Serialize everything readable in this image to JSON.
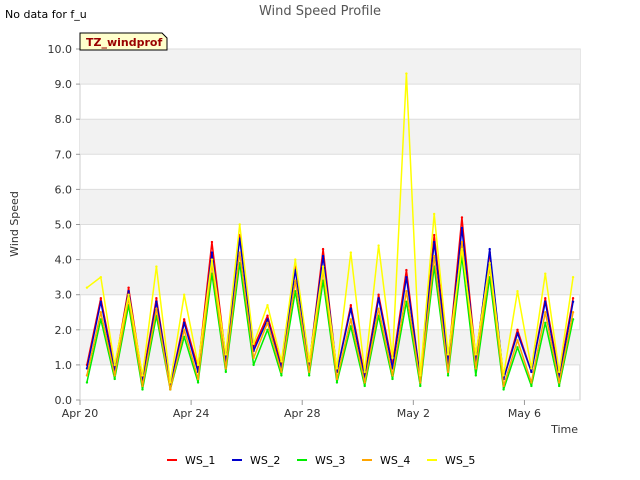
{
  "chart_data": {
    "type": "line",
    "title": "Wind Speed Profile",
    "corner_note": "No data for f_u",
    "tag": "TZ_windprof",
    "xlabel": "Time",
    "ylabel": "Wind Speed",
    "ylim": [
      0,
      10
    ],
    "xlim": [
      "2023-04-20",
      "2023-05-08"
    ],
    "y_ticks": [
      "0.0",
      "1.0",
      "2.0",
      "3.0",
      "4.0",
      "5.0",
      "6.0",
      "7.0",
      "8.0",
      "9.0",
      "10.0"
    ],
    "x_ticks": [
      {
        "date": "2023-04-20",
        "label": "Apr 20"
      },
      {
        "date": "2023-04-24",
        "label": "Apr 24"
      },
      {
        "date": "2023-04-28",
        "label": "Apr 28"
      },
      {
        "date": "2023-05-02",
        "label": "May 2"
      },
      {
        "date": "2023-05-06",
        "label": "May 6"
      }
    ],
    "grid": true,
    "legend_position": "bottom",
    "x": [
      "2023-04-20 06:00",
      "2023-04-20 18:00",
      "2023-04-21 06:00",
      "2023-04-21 18:00",
      "2023-04-22 06:00",
      "2023-04-22 18:00",
      "2023-04-23 06:00",
      "2023-04-23 18:00",
      "2023-04-24 06:00",
      "2023-04-24 18:00",
      "2023-04-25 06:00",
      "2023-04-25 18:00",
      "2023-04-26 06:00",
      "2023-04-26 18:00",
      "2023-04-27 06:00",
      "2023-04-27 18:00",
      "2023-04-28 06:00",
      "2023-04-28 18:00",
      "2023-04-29 06:00",
      "2023-04-29 18:00",
      "2023-04-30 06:00",
      "2023-04-30 18:00",
      "2023-05-01 06:00",
      "2023-05-01 18:00",
      "2023-05-02 06:00",
      "2023-05-02 18:00",
      "2023-05-03 06:00",
      "2023-05-03 18:00",
      "2023-05-04 06:00",
      "2023-05-04 18:00",
      "2023-05-05 06:00",
      "2023-05-05 18:00",
      "2023-05-06 06:00",
      "2023-05-06 18:00",
      "2023-05-07 06:00",
      "2023-05-07 18:00"
    ],
    "series": [
      {
        "name": "WS_1",
        "color": "#ff0000",
        "values": [
          1.0,
          2.9,
          0.9,
          3.2,
          0.6,
          2.9,
          0.4,
          2.3,
          0.9,
          4.5,
          1.2,
          4.7,
          1.5,
          2.4,
          1.0,
          3.8,
          1.0,
          4.3,
          0.8,
          2.7,
          0.7,
          3.0,
          1.0,
          3.7,
          0.6,
          4.7,
          1.1,
          5.2,
          1.2,
          4.2,
          0.6,
          2.0,
          0.8,
          2.9,
          0.7,
          2.9
        ]
      },
      {
        "name": "WS_2",
        "color": "#0000cc",
        "values": [
          0.9,
          2.8,
          0.8,
          3.1,
          0.5,
          2.8,
          0.4,
          2.2,
          0.8,
          4.2,
          1.1,
          4.6,
          1.4,
          2.3,
          0.9,
          3.7,
          1.0,
          4.1,
          0.8,
          2.6,
          0.6,
          2.9,
          0.9,
          3.5,
          0.6,
          4.5,
          1.0,
          4.9,
          1.1,
          4.3,
          0.6,
          1.9,
          0.8,
          2.8,
          0.6,
          2.8
        ]
      },
      {
        "name": "WS_3",
        "color": "#00ee00",
        "values": [
          0.5,
          2.3,
          0.6,
          2.7,
          0.3,
          2.4,
          0.3,
          1.8,
          0.5,
          3.6,
          0.8,
          3.9,
          1.0,
          2.0,
          0.7,
          3.1,
          0.7,
          3.4,
          0.5,
          2.1,
          0.4,
          2.4,
          0.6,
          2.8,
          0.4,
          3.8,
          0.7,
          4.1,
          0.7,
          3.5,
          0.3,
          1.5,
          0.4,
          2.2,
          0.4,
          2.3
        ]
      },
      {
        "name": "WS_4",
        "color": "#ffa500",
        "values": [
          0.7,
          2.5,
          0.7,
          2.9,
          0.4,
          2.6,
          0.3,
          2.0,
          0.6,
          3.9,
          0.9,
          4.2,
          1.2,
          2.2,
          0.8,
          3.4,
          0.8,
          3.7,
          0.6,
          2.3,
          0.5,
          2.6,
          0.7,
          3.1,
          0.5,
          4.1,
          0.8,
          4.5,
          0.9,
          3.8,
          0.4,
          1.7,
          0.5,
          2.5,
          0.5,
          2.5
        ]
      },
      {
        "name": "WS_5",
        "color": "#ffff00",
        "values": [
          3.2,
          3.5,
          1.0,
          3.0,
          0.7,
          3.8,
          0.5,
          3.0,
          1.0,
          4.0,
          1.3,
          5.0,
          1.6,
          2.7,
          1.1,
          4.0,
          1.1,
          3.8,
          0.9,
          4.2,
          0.8,
          4.4,
          1.2,
          9.3,
          0.7,
          5.3,
          1.3,
          4.3,
          1.3,
          3.9,
          0.7,
          3.1,
          0.9,
          3.6,
          0.8,
          3.5
        ]
      }
    ]
  }
}
